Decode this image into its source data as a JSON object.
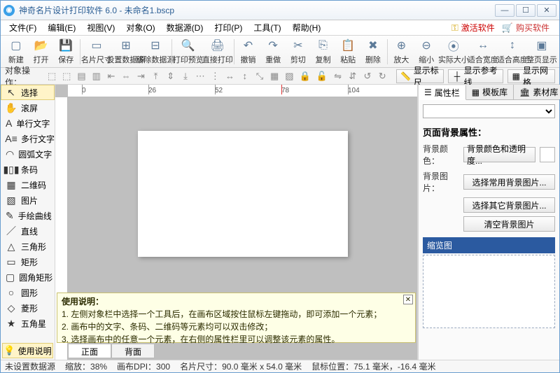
{
  "title": "神奇名片设计打印软件 6.0 - 未命名1.bscp",
  "window_buttons": {
    "min": "—",
    "max": "☐",
    "close": "✕"
  },
  "menu": [
    "文件(F)",
    "编辑(E)",
    "视图(V)",
    "对象(O)",
    "数据源(D)",
    "打印(P)",
    "工具(T)",
    "帮助(H)"
  ],
  "header_links": {
    "activate": "激活软件",
    "buy": "购买软件"
  },
  "toolbar": [
    {
      "id": "new",
      "label": "新建",
      "icon": "▢"
    },
    {
      "id": "open",
      "label": "打开",
      "icon": "📂"
    },
    {
      "id": "save",
      "label": "保存",
      "icon": "💾"
    },
    {
      "sep": true
    },
    {
      "id": "cardsize",
      "label": "名片尺寸",
      "icon": "▭"
    },
    {
      "id": "setds",
      "label": "设置数据源",
      "icon": "⊞"
    },
    {
      "id": "rmds",
      "label": "移除数据源",
      "icon": "⊟"
    },
    {
      "sep": true
    },
    {
      "id": "preview",
      "label": "打印预览",
      "icon": "🔍"
    },
    {
      "id": "print",
      "label": "直接打印",
      "icon": "🖨"
    },
    {
      "sep": true
    },
    {
      "id": "undo",
      "label": "撤销",
      "icon": "↶"
    },
    {
      "id": "redo",
      "label": "重做",
      "icon": "↷"
    },
    {
      "id": "cut",
      "label": "剪切",
      "icon": "✂"
    },
    {
      "id": "copy",
      "label": "复制",
      "icon": "⎘"
    },
    {
      "id": "paste",
      "label": "粘贴",
      "icon": "📋"
    },
    {
      "id": "delete",
      "label": "删除",
      "icon": "✖"
    },
    {
      "sep": true
    },
    {
      "id": "zoomin",
      "label": "放大",
      "icon": "⊕"
    },
    {
      "id": "zoomout",
      "label": "缩小",
      "icon": "⊖"
    },
    {
      "id": "actual",
      "label": "实际大小",
      "icon": "⦿"
    },
    {
      "id": "fitw",
      "label": "适合宽度",
      "icon": "↔"
    },
    {
      "id": "fith",
      "label": "适合高度",
      "icon": "↕"
    },
    {
      "id": "fitpage",
      "label": "整页显示",
      "icon": "▣"
    }
  ],
  "subrow_label": "对象操作：",
  "toggles": {
    "ruler": "显示标尺",
    "guides": "显示参考线",
    "grid": "显示网格"
  },
  "tools": [
    {
      "id": "select",
      "label": "选择",
      "icon": "↖",
      "sel": true
    },
    {
      "id": "pan",
      "label": "滚屏",
      "icon": "✋"
    },
    {
      "id": "text1",
      "label": "单行文字",
      "icon": "A"
    },
    {
      "id": "textm",
      "label": "多行文字",
      "icon": "A≡"
    },
    {
      "id": "arc",
      "label": "圆弧文字",
      "icon": "◠"
    },
    {
      "id": "barcode",
      "label": "条码",
      "icon": "▮▯▮"
    },
    {
      "id": "qrcode",
      "label": "二维码",
      "icon": "▦"
    },
    {
      "id": "image",
      "label": "图片",
      "icon": "▧"
    },
    {
      "id": "freehand",
      "label": "手绘曲线",
      "icon": "✎"
    },
    {
      "id": "line",
      "label": "直线",
      "icon": "／"
    },
    {
      "id": "tri",
      "label": "三角形",
      "icon": "△"
    },
    {
      "id": "rect",
      "label": "矩形",
      "icon": "▭"
    },
    {
      "id": "rrect",
      "label": "圆角矩形",
      "icon": "▢"
    },
    {
      "id": "circle",
      "label": "圆形",
      "icon": "○"
    },
    {
      "id": "diamond",
      "label": "菱形",
      "icon": "◇"
    },
    {
      "id": "star",
      "label": "五角星",
      "icon": "★"
    }
  ],
  "help_button": "使用说明",
  "ruler_ticks": [
    "0",
    "26",
    "52",
    "78",
    "104"
  ],
  "help_note": {
    "title": "使用说明：",
    "lines": [
      "1. 左侧对象栏中选择一个工具后，在画布区域按住鼠标左键拖动，即可添加一个元素；",
      "2. 画布中的文字、条码、二维码等元素均可以双击修改；",
      "3. 选择画布中的任意一个元素，在右侧的属性栏里可以调整该元素的属性。"
    ]
  },
  "bottom_tabs": {
    "front": "正面",
    "back": "背面"
  },
  "right": {
    "tabs": {
      "props": "属性栏",
      "templates": "模板库",
      "assets": "素材库"
    },
    "section_title": "页面背景属性：",
    "bgcolor_label": "背景颜色：",
    "bgcolor_btn": "背景颜色和透明度...",
    "bgimg_label": "背景图片：",
    "bgimg_btn1": "选择常用背景图片...",
    "bgimg_btn2": "选择其它背景图片...",
    "bgimg_btn3": "清空背景图片",
    "thumb_title": "缩览图"
  },
  "status": {
    "ds": "未设置数据源",
    "zoom": "缩放：38%",
    "dpi": "画布DPI：300",
    "size": "名片尺寸：90.0 毫米 x 54.0 毫米",
    "mouse": "鼠标位置：75.1 毫米，-16.4 毫米"
  }
}
